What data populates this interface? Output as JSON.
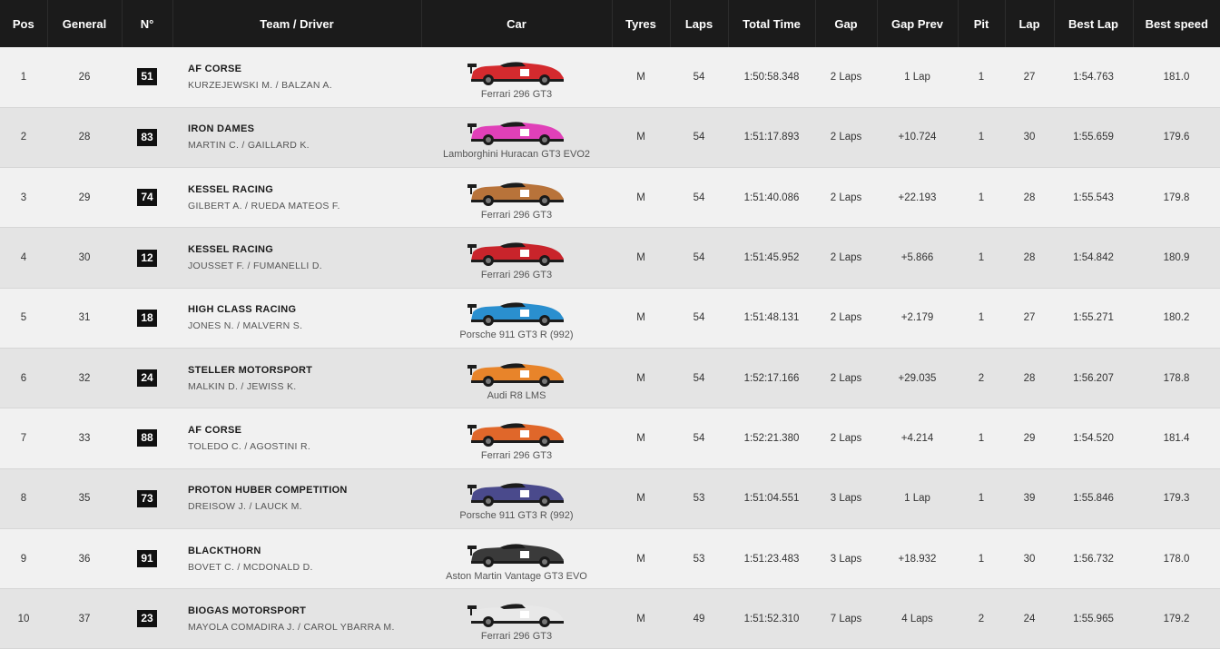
{
  "headers": {
    "pos": "Pos",
    "general": "General",
    "number": "N°",
    "team_driver": "Team / Driver",
    "car": "Car",
    "tyres": "Tyres",
    "laps": "Laps",
    "total_time": "Total Time",
    "gap": "Gap",
    "gap_prev": "Gap Prev",
    "pit": "Pit",
    "lap": "Lap",
    "best_lap": "Best Lap",
    "best_speed": "Best speed"
  },
  "rows": [
    {
      "pos": "1",
      "general": "26",
      "number": "51",
      "team": "AF CORSE",
      "drivers": "KURZEJEWSKI M. / BALZAN A.",
      "car": "Ferrari 296 GT3",
      "livery": "#d42a2e",
      "tyres": "M",
      "laps": "54",
      "total_time": "1:50:58.348",
      "gap": "2 Laps",
      "gap_prev": "1 Lap",
      "pit": "1",
      "lap": "27",
      "best_lap": "1:54.763",
      "best_speed": "181.0"
    },
    {
      "pos": "2",
      "general": "28",
      "number": "83",
      "team": "IRON DAMES",
      "drivers": "MARTIN C. / GAILLARD K.",
      "car": "Lamborghini Huracan GT3 EVO2",
      "livery": "#e040b8",
      "tyres": "M",
      "laps": "54",
      "total_time": "1:51:17.893",
      "gap": "2 Laps",
      "gap_prev": "+10.724",
      "pit": "1",
      "lap": "30",
      "best_lap": "1:55.659",
      "best_speed": "179.6"
    },
    {
      "pos": "3",
      "general": "29",
      "number": "74",
      "team": "KESSEL RACING",
      "drivers": "GILBERT A. / RUEDA MATEOS F.",
      "car": "Ferrari 296 GT3",
      "livery": "#b8733a",
      "tyres": "M",
      "laps": "54",
      "total_time": "1:51:40.086",
      "gap": "2 Laps",
      "gap_prev": "+22.193",
      "pit": "1",
      "lap": "28",
      "best_lap": "1:55.543",
      "best_speed": "179.8"
    },
    {
      "pos": "4",
      "general": "30",
      "number": "12",
      "team": "KESSEL RACING",
      "drivers": "JOUSSET F. / FUMANELLI D.",
      "car": "Ferrari 296 GT3",
      "livery": "#c9242b",
      "tyres": "M",
      "laps": "54",
      "total_time": "1:51:45.952",
      "gap": "2 Laps",
      "gap_prev": "+5.866",
      "pit": "1",
      "lap": "28",
      "best_lap": "1:54.842",
      "best_speed": "180.9"
    },
    {
      "pos": "5",
      "general": "31",
      "number": "18",
      "team": "HIGH CLASS RACING",
      "drivers": "JONES N. / MALVERN S.",
      "car": "Porsche 911 GT3 R (992)",
      "livery": "#2a8fcf",
      "tyres": "M",
      "laps": "54",
      "total_time": "1:51:48.131",
      "gap": "2 Laps",
      "gap_prev": "+2.179",
      "pit": "1",
      "lap": "27",
      "best_lap": "1:55.271",
      "best_speed": "180.2"
    },
    {
      "pos": "6",
      "general": "32",
      "number": "24",
      "team": "STELLER MOTORSPORT",
      "drivers": "MALKIN D. / JEWISS K.",
      "car": "Audi R8 LMS",
      "livery": "#e8842a",
      "tyres": "M",
      "laps": "54",
      "total_time": "1:52:17.166",
      "gap": "2 Laps",
      "gap_prev": "+29.035",
      "pit": "2",
      "lap": "28",
      "best_lap": "1:56.207",
      "best_speed": "178.8"
    },
    {
      "pos": "7",
      "general": "33",
      "number": "88",
      "team": "AF CORSE",
      "drivers": "TOLEDO C. / AGOSTINI R.",
      "car": "Ferrari 296 GT3",
      "livery": "#e0672a",
      "tyres": "M",
      "laps": "54",
      "total_time": "1:52:21.380",
      "gap": "2 Laps",
      "gap_prev": "+4.214",
      "pit": "1",
      "lap": "29",
      "best_lap": "1:54.520",
      "best_speed": "181.4"
    },
    {
      "pos": "8",
      "general": "35",
      "number": "73",
      "team": "PROTON HUBER COMPETITION",
      "drivers": "DREISOW J. / LAUCK M.",
      "car": "Porsche 911 GT3 R (992)",
      "livery": "#4a4a8c",
      "tyres": "M",
      "laps": "53",
      "total_time": "1:51:04.551",
      "gap": "3 Laps",
      "gap_prev": "1 Lap",
      "pit": "1",
      "lap": "39",
      "best_lap": "1:55.846",
      "best_speed": "179.3"
    },
    {
      "pos": "9",
      "general": "36",
      "number": "91",
      "team": "BLACKTHORN",
      "drivers": "BOVET C. / MCDONALD D.",
      "car": "Aston Martin Vantage GT3 EVO",
      "livery": "#3a3a3a",
      "tyres": "M",
      "laps": "53",
      "total_time": "1:51:23.483",
      "gap": "3 Laps",
      "gap_prev": "+18.932",
      "pit": "1",
      "lap": "30",
      "best_lap": "1:56.732",
      "best_speed": "178.0"
    },
    {
      "pos": "10",
      "general": "37",
      "number": "23",
      "team": "BIOGAS MOTORSPORT",
      "drivers": "MAYOLA COMADIRA J. / CAROL YBARRA M.",
      "car": "Ferrari 296 GT3",
      "livery": "#e8e8e8",
      "tyres": "M",
      "laps": "49",
      "total_time": "1:51:52.310",
      "gap": "7 Laps",
      "gap_prev": "4 Laps",
      "pit": "2",
      "lap": "24",
      "best_lap": "1:55.965",
      "best_speed": "179.2"
    }
  ]
}
